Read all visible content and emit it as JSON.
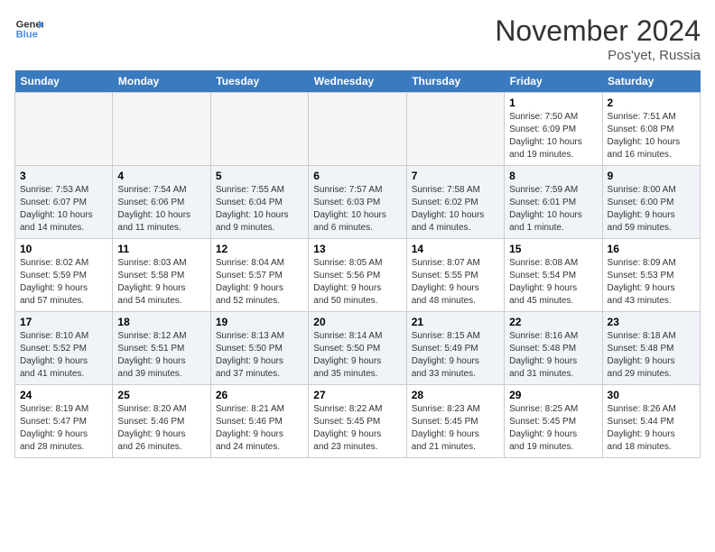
{
  "logo": {
    "line1": "General",
    "line2": "Blue"
  },
  "title": "November 2024",
  "location": "Pos'yet, Russia",
  "weekdays": [
    "Sunday",
    "Monday",
    "Tuesday",
    "Wednesday",
    "Thursday",
    "Friday",
    "Saturday"
  ],
  "weeks": [
    [
      {
        "day": "",
        "detail": "",
        "empty": true
      },
      {
        "day": "",
        "detail": "",
        "empty": true
      },
      {
        "day": "",
        "detail": "",
        "empty": true
      },
      {
        "day": "",
        "detail": "",
        "empty": true
      },
      {
        "day": "",
        "detail": "",
        "empty": true
      },
      {
        "day": "1",
        "detail": "Sunrise: 7:50 AM\nSunset: 6:09 PM\nDaylight: 10 hours\nand 19 minutes.",
        "empty": false
      },
      {
        "day": "2",
        "detail": "Sunrise: 7:51 AM\nSunset: 6:08 PM\nDaylight: 10 hours\nand 16 minutes.",
        "empty": false
      }
    ],
    [
      {
        "day": "3",
        "detail": "Sunrise: 7:53 AM\nSunset: 6:07 PM\nDaylight: 10 hours\nand 14 minutes.",
        "empty": false
      },
      {
        "day": "4",
        "detail": "Sunrise: 7:54 AM\nSunset: 6:06 PM\nDaylight: 10 hours\nand 11 minutes.",
        "empty": false
      },
      {
        "day": "5",
        "detail": "Sunrise: 7:55 AM\nSunset: 6:04 PM\nDaylight: 10 hours\nand 9 minutes.",
        "empty": false
      },
      {
        "day": "6",
        "detail": "Sunrise: 7:57 AM\nSunset: 6:03 PM\nDaylight: 10 hours\nand 6 minutes.",
        "empty": false
      },
      {
        "day": "7",
        "detail": "Sunrise: 7:58 AM\nSunset: 6:02 PM\nDaylight: 10 hours\nand 4 minutes.",
        "empty": false
      },
      {
        "day": "8",
        "detail": "Sunrise: 7:59 AM\nSunset: 6:01 PM\nDaylight: 10 hours\nand 1 minute.",
        "empty": false
      },
      {
        "day": "9",
        "detail": "Sunrise: 8:00 AM\nSunset: 6:00 PM\nDaylight: 9 hours\nand 59 minutes.",
        "empty": false
      }
    ],
    [
      {
        "day": "10",
        "detail": "Sunrise: 8:02 AM\nSunset: 5:59 PM\nDaylight: 9 hours\nand 57 minutes.",
        "empty": false
      },
      {
        "day": "11",
        "detail": "Sunrise: 8:03 AM\nSunset: 5:58 PM\nDaylight: 9 hours\nand 54 minutes.",
        "empty": false
      },
      {
        "day": "12",
        "detail": "Sunrise: 8:04 AM\nSunset: 5:57 PM\nDaylight: 9 hours\nand 52 minutes.",
        "empty": false
      },
      {
        "day": "13",
        "detail": "Sunrise: 8:05 AM\nSunset: 5:56 PM\nDaylight: 9 hours\nand 50 minutes.",
        "empty": false
      },
      {
        "day": "14",
        "detail": "Sunrise: 8:07 AM\nSunset: 5:55 PM\nDaylight: 9 hours\nand 48 minutes.",
        "empty": false
      },
      {
        "day": "15",
        "detail": "Sunrise: 8:08 AM\nSunset: 5:54 PM\nDaylight: 9 hours\nand 45 minutes.",
        "empty": false
      },
      {
        "day": "16",
        "detail": "Sunrise: 8:09 AM\nSunset: 5:53 PM\nDaylight: 9 hours\nand 43 minutes.",
        "empty": false
      }
    ],
    [
      {
        "day": "17",
        "detail": "Sunrise: 8:10 AM\nSunset: 5:52 PM\nDaylight: 9 hours\nand 41 minutes.",
        "empty": false
      },
      {
        "day": "18",
        "detail": "Sunrise: 8:12 AM\nSunset: 5:51 PM\nDaylight: 9 hours\nand 39 minutes.",
        "empty": false
      },
      {
        "day": "19",
        "detail": "Sunrise: 8:13 AM\nSunset: 5:50 PM\nDaylight: 9 hours\nand 37 minutes.",
        "empty": false
      },
      {
        "day": "20",
        "detail": "Sunrise: 8:14 AM\nSunset: 5:50 PM\nDaylight: 9 hours\nand 35 minutes.",
        "empty": false
      },
      {
        "day": "21",
        "detail": "Sunrise: 8:15 AM\nSunset: 5:49 PM\nDaylight: 9 hours\nand 33 minutes.",
        "empty": false
      },
      {
        "day": "22",
        "detail": "Sunrise: 8:16 AM\nSunset: 5:48 PM\nDaylight: 9 hours\nand 31 minutes.",
        "empty": false
      },
      {
        "day": "23",
        "detail": "Sunrise: 8:18 AM\nSunset: 5:48 PM\nDaylight: 9 hours\nand 29 minutes.",
        "empty": false
      }
    ],
    [
      {
        "day": "24",
        "detail": "Sunrise: 8:19 AM\nSunset: 5:47 PM\nDaylight: 9 hours\nand 28 minutes.",
        "empty": false
      },
      {
        "day": "25",
        "detail": "Sunrise: 8:20 AM\nSunset: 5:46 PM\nDaylight: 9 hours\nand 26 minutes.",
        "empty": false
      },
      {
        "day": "26",
        "detail": "Sunrise: 8:21 AM\nSunset: 5:46 PM\nDaylight: 9 hours\nand 24 minutes.",
        "empty": false
      },
      {
        "day": "27",
        "detail": "Sunrise: 8:22 AM\nSunset: 5:45 PM\nDaylight: 9 hours\nand 23 minutes.",
        "empty": false
      },
      {
        "day": "28",
        "detail": "Sunrise: 8:23 AM\nSunset: 5:45 PM\nDaylight: 9 hours\nand 21 minutes.",
        "empty": false
      },
      {
        "day": "29",
        "detail": "Sunrise: 8:25 AM\nSunset: 5:45 PM\nDaylight: 9 hours\nand 19 minutes.",
        "empty": false
      },
      {
        "day": "30",
        "detail": "Sunrise: 8:26 AM\nSunset: 5:44 PM\nDaylight: 9 hours\nand 18 minutes.",
        "empty": false
      }
    ]
  ]
}
